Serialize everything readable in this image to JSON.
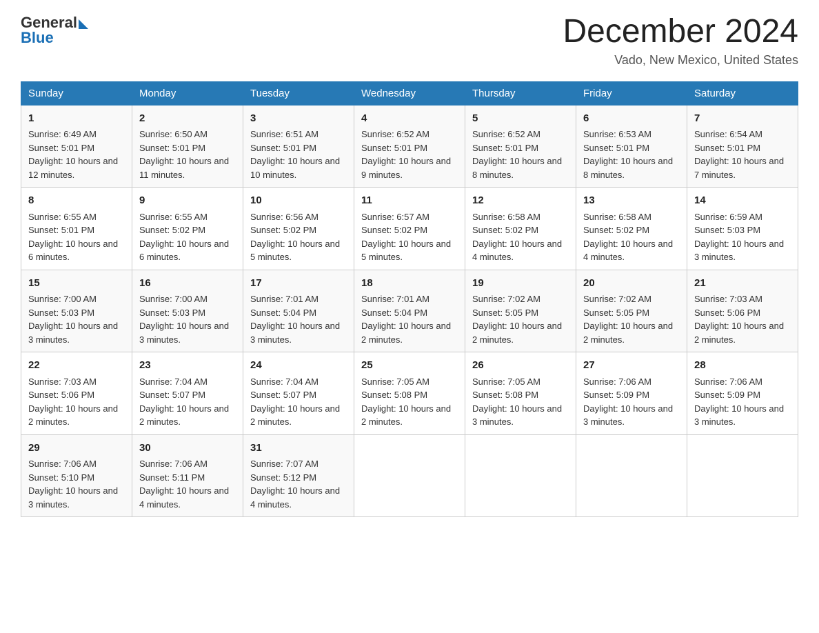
{
  "header": {
    "logo": {
      "general": "General",
      "blue": "Blue"
    },
    "title": "December 2024",
    "subtitle": "Vado, New Mexico, United States"
  },
  "days_of_week": [
    "Sunday",
    "Monday",
    "Tuesday",
    "Wednesday",
    "Thursday",
    "Friday",
    "Saturday"
  ],
  "weeks": [
    [
      {
        "day": "1",
        "sunrise": "6:49 AM",
        "sunset": "5:01 PM",
        "daylight": "10 hours and 12 minutes."
      },
      {
        "day": "2",
        "sunrise": "6:50 AM",
        "sunset": "5:01 PM",
        "daylight": "10 hours and 11 minutes."
      },
      {
        "day": "3",
        "sunrise": "6:51 AM",
        "sunset": "5:01 PM",
        "daylight": "10 hours and 10 minutes."
      },
      {
        "day": "4",
        "sunrise": "6:52 AM",
        "sunset": "5:01 PM",
        "daylight": "10 hours and 9 minutes."
      },
      {
        "day": "5",
        "sunrise": "6:52 AM",
        "sunset": "5:01 PM",
        "daylight": "10 hours and 8 minutes."
      },
      {
        "day": "6",
        "sunrise": "6:53 AM",
        "sunset": "5:01 PM",
        "daylight": "10 hours and 8 minutes."
      },
      {
        "day": "7",
        "sunrise": "6:54 AM",
        "sunset": "5:01 PM",
        "daylight": "10 hours and 7 minutes."
      }
    ],
    [
      {
        "day": "8",
        "sunrise": "6:55 AM",
        "sunset": "5:01 PM",
        "daylight": "10 hours and 6 minutes."
      },
      {
        "day": "9",
        "sunrise": "6:55 AM",
        "sunset": "5:02 PM",
        "daylight": "10 hours and 6 minutes."
      },
      {
        "day": "10",
        "sunrise": "6:56 AM",
        "sunset": "5:02 PM",
        "daylight": "10 hours and 5 minutes."
      },
      {
        "day": "11",
        "sunrise": "6:57 AM",
        "sunset": "5:02 PM",
        "daylight": "10 hours and 5 minutes."
      },
      {
        "day": "12",
        "sunrise": "6:58 AM",
        "sunset": "5:02 PM",
        "daylight": "10 hours and 4 minutes."
      },
      {
        "day": "13",
        "sunrise": "6:58 AM",
        "sunset": "5:02 PM",
        "daylight": "10 hours and 4 minutes."
      },
      {
        "day": "14",
        "sunrise": "6:59 AM",
        "sunset": "5:03 PM",
        "daylight": "10 hours and 3 minutes."
      }
    ],
    [
      {
        "day": "15",
        "sunrise": "7:00 AM",
        "sunset": "5:03 PM",
        "daylight": "10 hours and 3 minutes."
      },
      {
        "day": "16",
        "sunrise": "7:00 AM",
        "sunset": "5:03 PM",
        "daylight": "10 hours and 3 minutes."
      },
      {
        "day": "17",
        "sunrise": "7:01 AM",
        "sunset": "5:04 PM",
        "daylight": "10 hours and 3 minutes."
      },
      {
        "day": "18",
        "sunrise": "7:01 AM",
        "sunset": "5:04 PM",
        "daylight": "10 hours and 2 minutes."
      },
      {
        "day": "19",
        "sunrise": "7:02 AM",
        "sunset": "5:05 PM",
        "daylight": "10 hours and 2 minutes."
      },
      {
        "day": "20",
        "sunrise": "7:02 AM",
        "sunset": "5:05 PM",
        "daylight": "10 hours and 2 minutes."
      },
      {
        "day": "21",
        "sunrise": "7:03 AM",
        "sunset": "5:06 PM",
        "daylight": "10 hours and 2 minutes."
      }
    ],
    [
      {
        "day": "22",
        "sunrise": "7:03 AM",
        "sunset": "5:06 PM",
        "daylight": "10 hours and 2 minutes."
      },
      {
        "day": "23",
        "sunrise": "7:04 AM",
        "sunset": "5:07 PM",
        "daylight": "10 hours and 2 minutes."
      },
      {
        "day": "24",
        "sunrise": "7:04 AM",
        "sunset": "5:07 PM",
        "daylight": "10 hours and 2 minutes."
      },
      {
        "day": "25",
        "sunrise": "7:05 AM",
        "sunset": "5:08 PM",
        "daylight": "10 hours and 2 minutes."
      },
      {
        "day": "26",
        "sunrise": "7:05 AM",
        "sunset": "5:08 PM",
        "daylight": "10 hours and 3 minutes."
      },
      {
        "day": "27",
        "sunrise": "7:06 AM",
        "sunset": "5:09 PM",
        "daylight": "10 hours and 3 minutes."
      },
      {
        "day": "28",
        "sunrise": "7:06 AM",
        "sunset": "5:09 PM",
        "daylight": "10 hours and 3 minutes."
      }
    ],
    [
      {
        "day": "29",
        "sunrise": "7:06 AM",
        "sunset": "5:10 PM",
        "daylight": "10 hours and 3 minutes."
      },
      {
        "day": "30",
        "sunrise": "7:06 AM",
        "sunset": "5:11 PM",
        "daylight": "10 hours and 4 minutes."
      },
      {
        "day": "31",
        "sunrise": "7:07 AM",
        "sunset": "5:12 PM",
        "daylight": "10 hours and 4 minutes."
      },
      null,
      null,
      null,
      null
    ]
  ],
  "labels": {
    "sunrise": "Sunrise:",
    "sunset": "Sunset:",
    "daylight": "Daylight:"
  }
}
